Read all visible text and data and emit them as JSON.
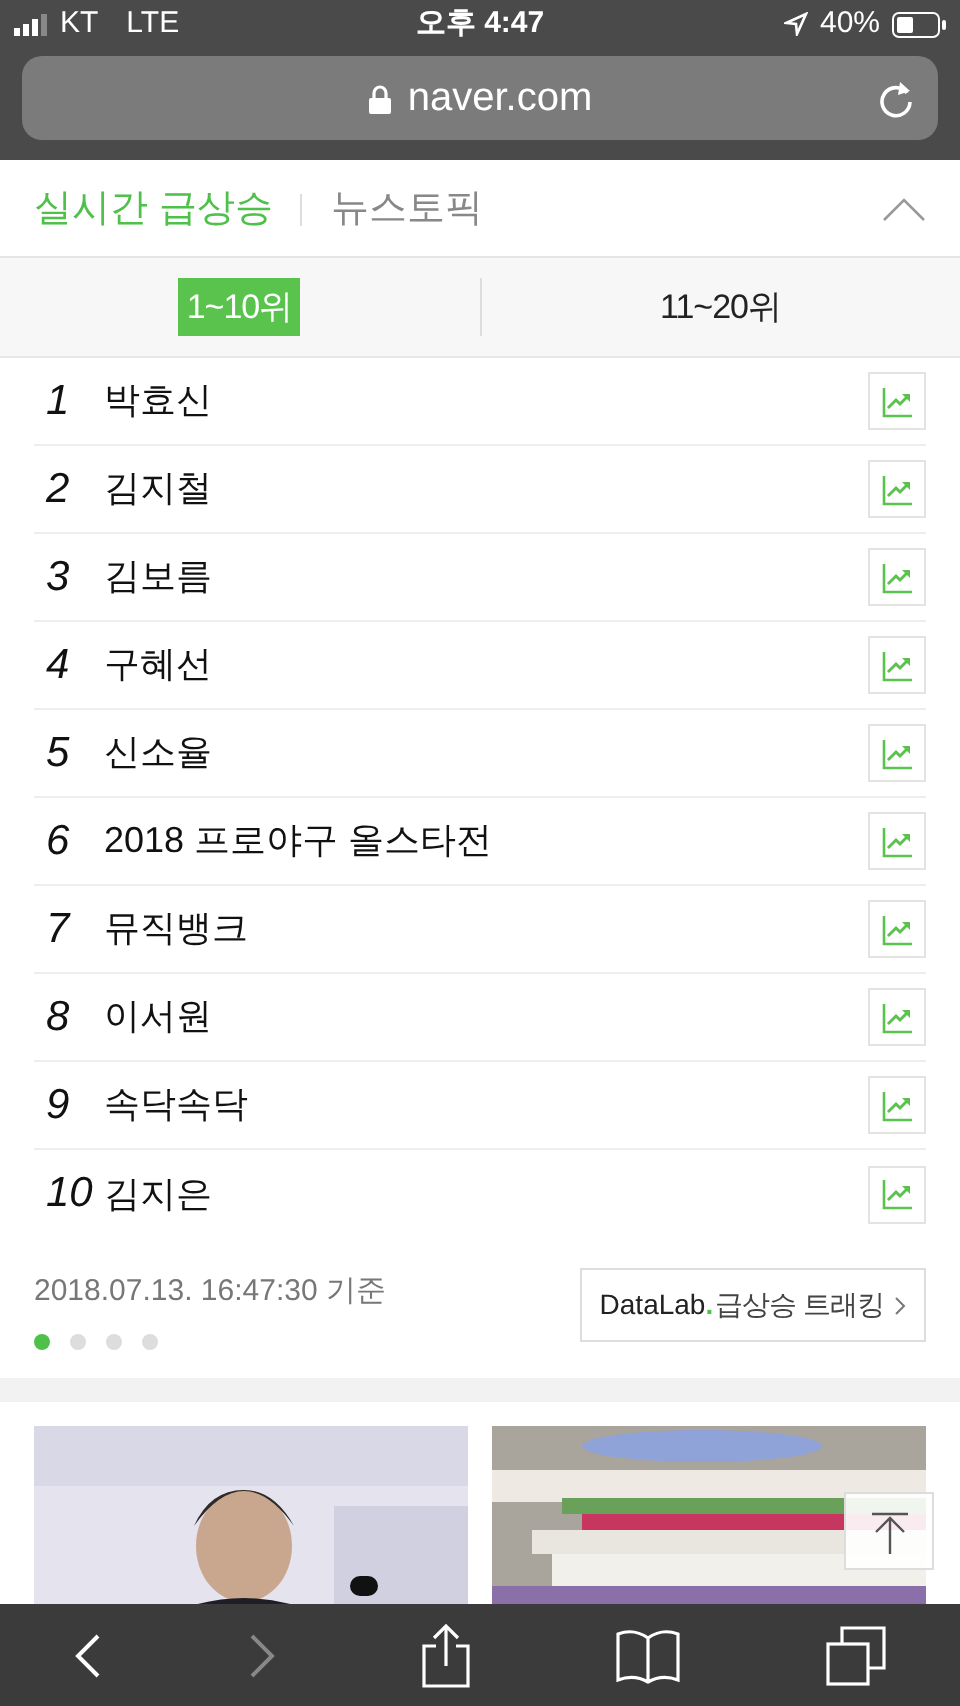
{
  "status_bar": {
    "carrier": "KT",
    "network": "LTE",
    "time": "오후 4:47",
    "battery": "40%"
  },
  "address_bar": {
    "url": "naver.com"
  },
  "section_tabs": [
    {
      "label": "실시간 급상승",
      "selected": true
    },
    {
      "label": "뉴스토픽",
      "selected": false
    }
  ],
  "range_tabs": [
    {
      "label": "1~10위",
      "selected": true
    },
    {
      "label": "11~20위",
      "selected": false
    }
  ],
  "rankings": [
    {
      "rank": "1",
      "keyword": "박효신"
    },
    {
      "rank": "2",
      "keyword": "김지철"
    },
    {
      "rank": "3",
      "keyword": "김보름"
    },
    {
      "rank": "4",
      "keyword": "구혜선"
    },
    {
      "rank": "5",
      "keyword": "신소율"
    },
    {
      "rank": "6",
      "keyword": "2018 프로야구 올스타전"
    },
    {
      "rank": "7",
      "keyword": "뮤직뱅크"
    },
    {
      "rank": "8",
      "keyword": "이서원"
    },
    {
      "rank": "9",
      "keyword": "속닥속닥"
    },
    {
      "rank": "10",
      "keyword": "김지은"
    }
  ],
  "timestamp": "2018.07.13. 16:47:30 기준",
  "pager": [
    {
      "selected": true
    },
    {
      "selected": false
    },
    {
      "selected": false
    },
    {
      "selected": false
    }
  ],
  "datalab_button": {
    "brand": "DataLab",
    "dot": ".",
    "label": "급상승 트래킹"
  },
  "toolbar": {
    "back_disabled": false,
    "forward_disabled": true
  }
}
